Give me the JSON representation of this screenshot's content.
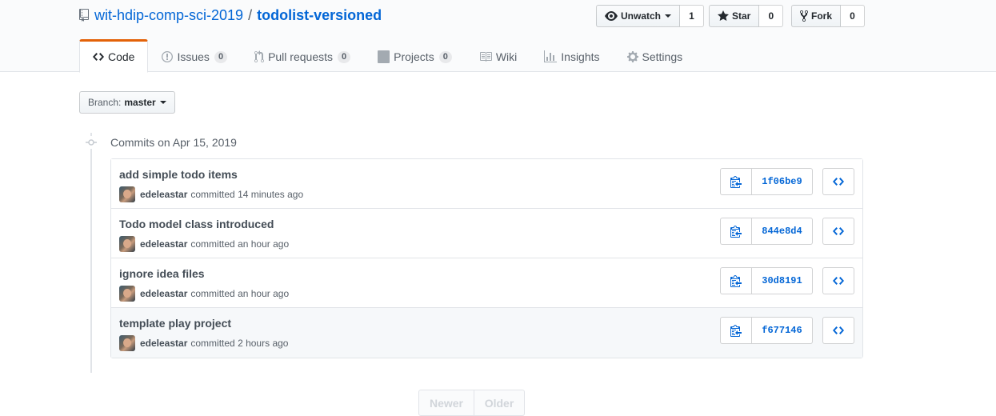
{
  "repo": {
    "owner": "wit-hdip-comp-sci-2019",
    "separator": "/",
    "name": "todolist-versioned"
  },
  "actions": {
    "watch": {
      "label": "Unwatch",
      "count": "1"
    },
    "star": {
      "label": "Star",
      "count": "0"
    },
    "fork": {
      "label": "Fork",
      "count": "0"
    }
  },
  "tabs": [
    {
      "label": "Code",
      "icon": "code-icon",
      "selected": true
    },
    {
      "label": "Issues",
      "icon": "issue-opened-icon",
      "count": "0"
    },
    {
      "label": "Pull requests",
      "icon": "git-pull-request-icon",
      "count": "0"
    },
    {
      "label": "Projects",
      "icon": "project-icon",
      "count": "0"
    },
    {
      "label": "Wiki",
      "icon": "book-icon"
    },
    {
      "label": "Insights",
      "icon": "graph-icon"
    },
    {
      "label": "Settings",
      "icon": "gear-icon"
    }
  ],
  "branch": {
    "prefix": "Branch:",
    "name": "master"
  },
  "commit_group": {
    "title": "Commits on Apr 15, 2019"
  },
  "commits": [
    {
      "message": "add simple todo items",
      "author": "edeleastar",
      "action": "committed",
      "time": "14 minutes ago",
      "sha": "1f06be9"
    },
    {
      "message": "Todo model class introduced",
      "author": "edeleastar",
      "action": "committed",
      "time": "an hour ago",
      "sha": "844e8d4"
    },
    {
      "message": "ignore idea files",
      "author": "edeleastar",
      "action": "committed",
      "time": "an hour ago",
      "sha": "30d8191"
    },
    {
      "message": "template play project",
      "author": "edeleastar",
      "action": "committed",
      "time": "2 hours ago",
      "sha": "f677146"
    }
  ],
  "pagination": {
    "newer": "Newer",
    "older": "Older"
  },
  "colors": {
    "accent": "#e36209",
    "link": "#0366d6"
  }
}
